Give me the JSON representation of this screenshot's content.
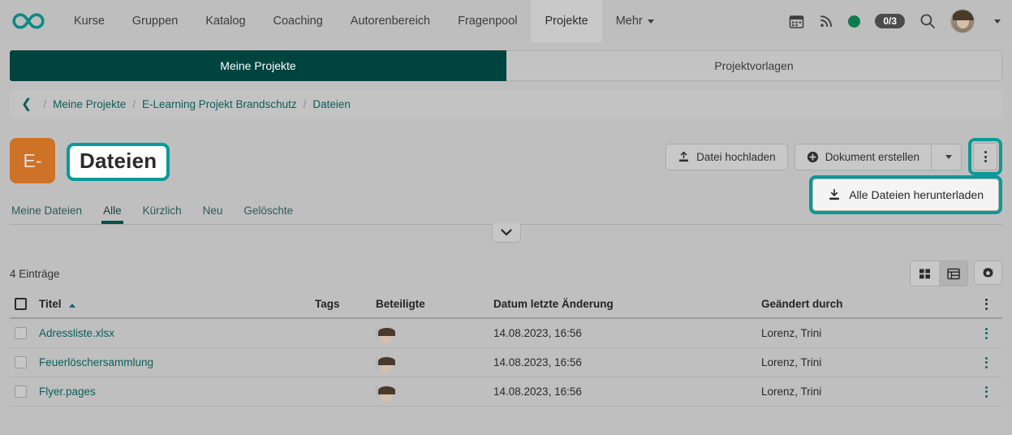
{
  "topnav": {
    "logo_icon": "infinity-logo-icon",
    "items": [
      {
        "label": "Kurse",
        "active": false
      },
      {
        "label": "Gruppen",
        "active": false
      },
      {
        "label": "Katalog",
        "active": false
      },
      {
        "label": "Coaching",
        "active": false
      },
      {
        "label": "Autorenbereich",
        "active": false
      },
      {
        "label": "Fragenpool",
        "active": false
      },
      {
        "label": "Projekte",
        "active": true
      },
      {
        "label": "Mehr",
        "active": false
      }
    ],
    "right": {
      "calendar_icon": "calendar-icon",
      "rss_icon": "rss-icon",
      "status_dot": "green-status-dot",
      "task_badge": "0/3",
      "search_icon": "search-icon",
      "avatar": "user-avatar",
      "avatar_caret": "chevron-down-icon"
    }
  },
  "segmented_tabs": [
    {
      "label": "Meine Projekte",
      "active": true
    },
    {
      "label": "Projektvorlagen",
      "active": false
    }
  ],
  "breadcrumb": {
    "back_icon": "chevron-left-icon",
    "items": [
      "Meine Projekte",
      "E-Learning Projekt Brandschutz",
      "Dateien"
    ],
    "separator": "/"
  },
  "page": {
    "project_badge": "E-",
    "title": "Dateien"
  },
  "toolbar": {
    "upload_label": "Datei hochladen",
    "upload_icon": "upload-icon",
    "create_label": "Dokument erstellen",
    "create_icon": "plus-circle-icon",
    "split_caret_icon": "caret-down-icon",
    "kebab_icon": "kebab-menu-icon"
  },
  "dropdown": {
    "item_label": "Alle Dateien herunterladen",
    "item_icon": "download-icon"
  },
  "subtabs": [
    {
      "label": "Meine Dateien",
      "active": false
    },
    {
      "label": "Alle",
      "active": true
    },
    {
      "label": "Kürzlich",
      "active": false
    },
    {
      "label": "Neu",
      "active": false
    },
    {
      "label": "Gelöschte",
      "active": false
    }
  ],
  "filter_collapse_icon": "chevron-down-icon",
  "list": {
    "count_label": "4 Einträge",
    "view_tiles_icon": "grid-view-icon",
    "view_list_icon": "list-view-icon",
    "settings_icon": "gear-icon",
    "columns": {
      "title": "Titel",
      "tags": "Tags",
      "participants": "Beteiligte",
      "modified_date": "Datum letzte Änderung",
      "modified_by": "Geändert durch"
    },
    "sort_icon": "sort-ascending-icon",
    "header_kebab_icon": "kebab-menu-icon",
    "rows": [
      {
        "title": "Adressliste.xlsx",
        "tags": "",
        "participant_avatar": "user-avatar",
        "modified_date": "14.08.2023, 16:56",
        "modified_by": "Lorenz, Trini",
        "row_menu_icon": "kebab-menu-icon"
      },
      {
        "title": "Feuerlöschersammlung",
        "tags": "",
        "participant_avatar": "user-avatar",
        "modified_date": "14.08.2023, 16:56",
        "modified_by": "Lorenz, Trini",
        "row_menu_icon": "kebab-menu-icon"
      },
      {
        "title": "Flyer.pages",
        "tags": "",
        "participant_avatar": "user-avatar",
        "modified_date": "14.08.2023, 16:56",
        "modified_by": "Lorenz, Trini",
        "row_menu_icon": "kebab-menu-icon"
      }
    ]
  },
  "colors": {
    "accent_dark_teal": "#00443f",
    "accent_teal": "#0b5f58",
    "highlight_teal": "#0b9a96",
    "project_orange": "#cd7226",
    "status_green": "#0e7a4f",
    "page_background": "#bfbfbf"
  }
}
